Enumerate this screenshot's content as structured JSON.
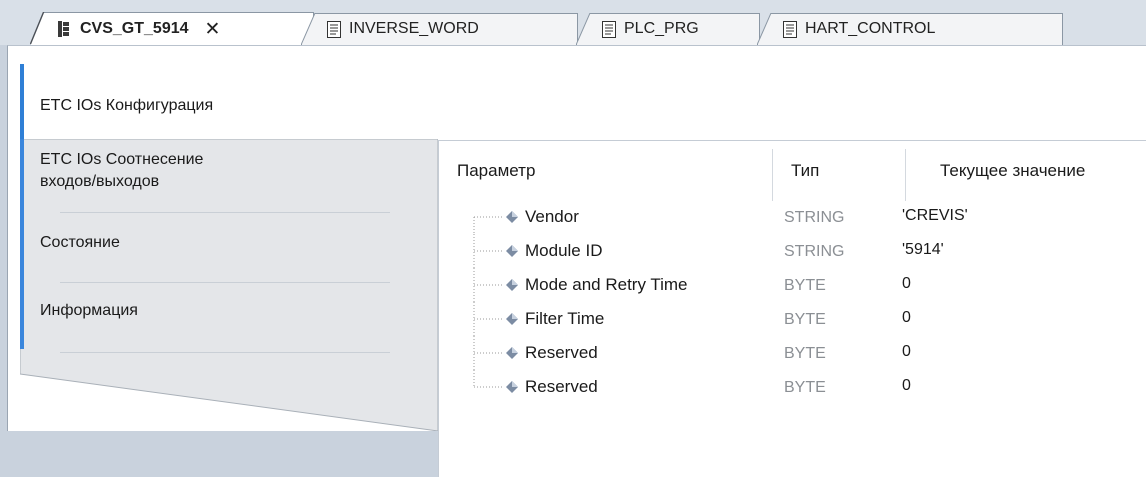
{
  "tabs": [
    {
      "label": "CVS_GT_5914",
      "active": true,
      "icon": "device-icon",
      "close": "✕"
    },
    {
      "label": "INVERSE_WORD",
      "active": false,
      "icon": "document-icon"
    },
    {
      "label": "PLC_PRG",
      "active": false,
      "icon": "document-icon"
    },
    {
      "label": "HART_CONTROL",
      "active": false,
      "icon": "document-icon"
    }
  ],
  "sidebar": {
    "items": [
      {
        "label": "ETC IOs Конфигурация",
        "active": true
      },
      {
        "label_line1": "ETC IOs Соотнесение",
        "label_line2": "входов/выходов",
        "active": false
      },
      {
        "label": "Состояние",
        "active": false
      },
      {
        "label": "Информация",
        "active": false
      }
    ]
  },
  "table": {
    "headers": {
      "param": "Параметр",
      "type": "Тип",
      "value": "Текущее значение"
    },
    "rows": [
      {
        "param": "Vendor",
        "type": "STRING",
        "value": "'CREVIS'"
      },
      {
        "param": "Module ID",
        "type": "STRING",
        "value": "'5914'"
      },
      {
        "param": "Mode and Retry Time",
        "type": "BYTE",
        "value": "0"
      },
      {
        "param": "Filter Time",
        "type": "BYTE",
        "value": "0"
      },
      {
        "param": "Reserved",
        "type": "BYTE",
        "value": "0"
      },
      {
        "param": "Reserved",
        "type": "BYTE",
        "value": "0"
      }
    ]
  },
  "colors": {
    "accent": "#2f7fd6",
    "tab_border": "#8b97a4",
    "type_text": "#8b8f94"
  }
}
